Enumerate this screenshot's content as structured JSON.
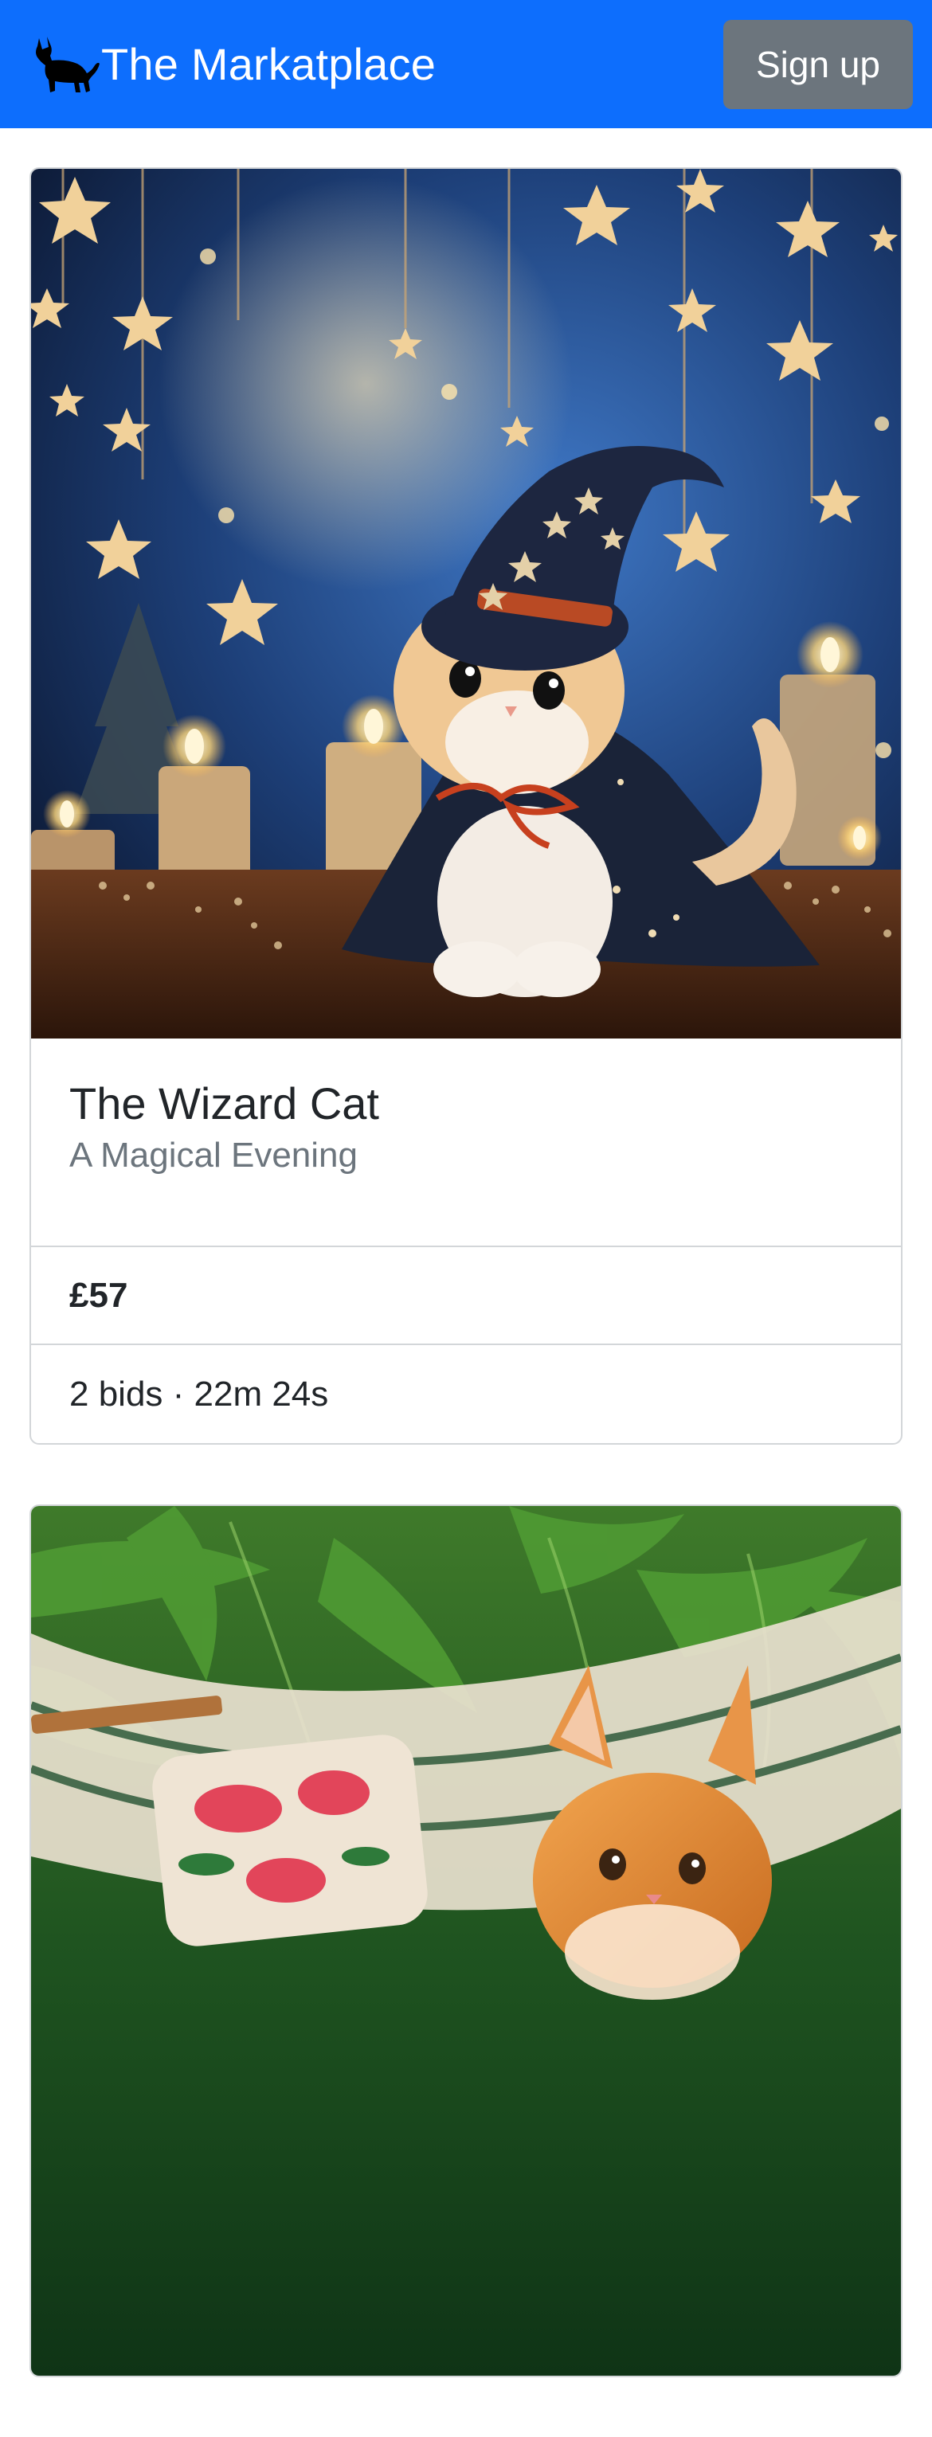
{
  "navbar": {
    "brand_icon": "black-cat-icon",
    "brand_name": "The Markatplace",
    "signup_label": "Sign up",
    "background_color": "#0d6efd",
    "signup_color": "#6c757d"
  },
  "listings": [
    {
      "image": "wizard-cat-photo",
      "title": "The Wizard Cat",
      "subtitle": "A Magical Evening",
      "price": "£57",
      "bids_text": "2 bids · 22m 24s"
    },
    {
      "image": "hammock-kitten-photo"
    }
  ]
}
